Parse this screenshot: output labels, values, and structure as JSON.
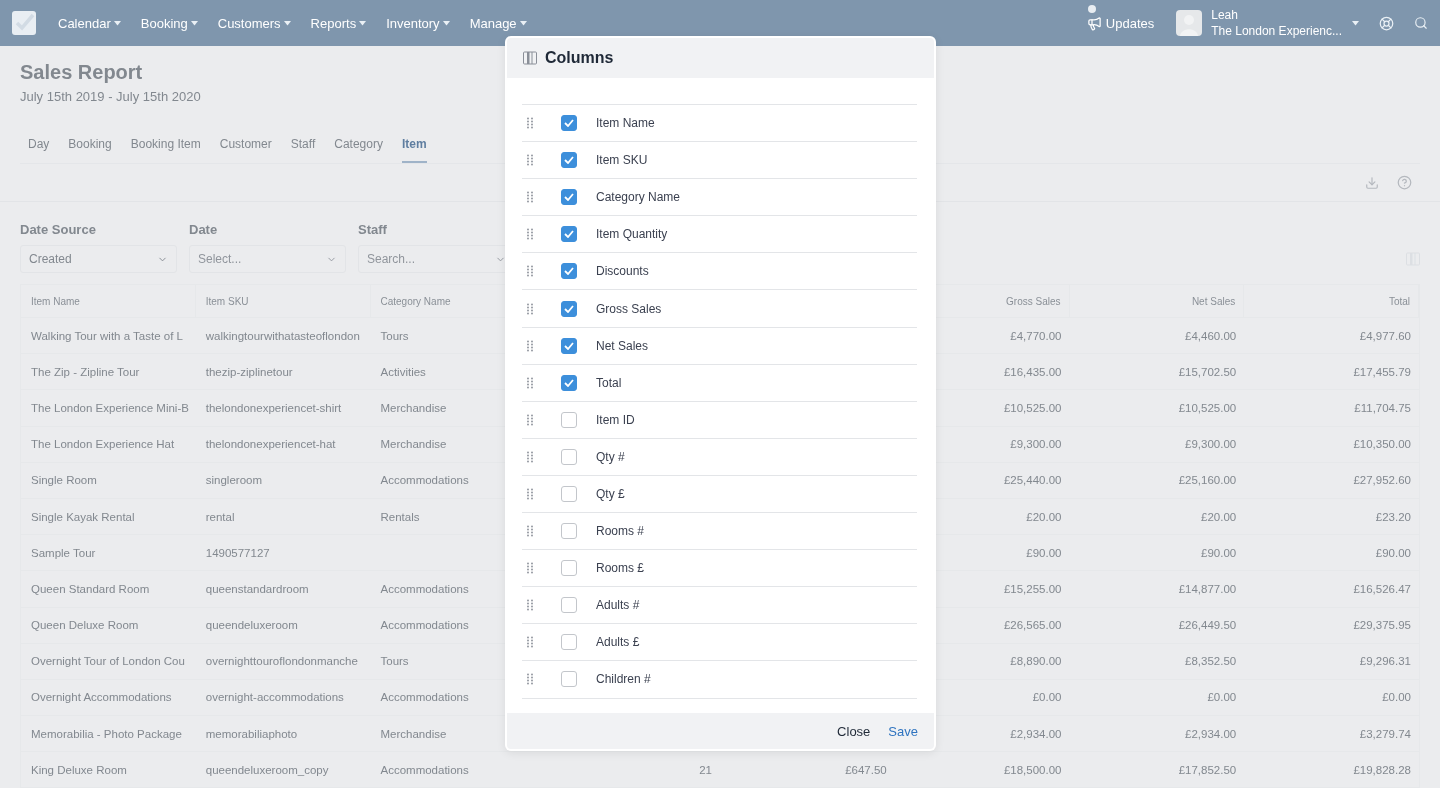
{
  "nav": {
    "menu": [
      {
        "label": "Calendar"
      },
      {
        "label": "Booking"
      },
      {
        "label": "Customers"
      },
      {
        "label": "Reports"
      },
      {
        "label": "Inventory"
      },
      {
        "label": "Manage"
      }
    ],
    "updates": {
      "label": "Updates",
      "unread": true
    },
    "user": {
      "name": "Leah",
      "org": "The London Experienc..."
    }
  },
  "report": {
    "title": "Sales Report",
    "subtitle": "July 15th 2019 - July 15th 2020",
    "tabs": [
      {
        "label": "Day",
        "selected": false
      },
      {
        "label": "Booking",
        "selected": false
      },
      {
        "label": "Booking Item",
        "selected": false
      },
      {
        "label": "Customer",
        "selected": false
      },
      {
        "label": "Staff",
        "selected": false
      },
      {
        "label": "Category",
        "selected": false
      },
      {
        "label": "Item",
        "selected": true
      }
    ]
  },
  "filters": [
    {
      "label": "Date Source",
      "value": "Created"
    },
    {
      "label": "Date",
      "placeholder": "Select..."
    },
    {
      "label": "Staff",
      "placeholder": "Search..."
    }
  ],
  "table": {
    "columns": {
      "item_name": "Item Name",
      "item_sku": "Item SKU",
      "category_name": "Category Name",
      "gross_sales": "Gross Sales",
      "net_sales": "Net Sales",
      "total": "Total"
    },
    "rows": [
      {
        "item_name": "Walking Tour with a Taste of L",
        "item_sku": "walkingtourwithatasteoflondon",
        "category_name": "Tours",
        "gross_sales": "£4,770.00",
        "net_sales": "£4,460.00",
        "total": "£4,977.60"
      },
      {
        "item_name": "The Zip - Zipline Tour",
        "item_sku": "thezip-ziplinetour",
        "category_name": "Activities",
        "gross_sales": "£16,435.00",
        "net_sales": "£15,702.50",
        "total": "£17,455.79"
      },
      {
        "item_name": "The London Experience Mini-B",
        "item_sku": "thelondonexperiencet-shirt",
        "category_name": "Merchandise",
        "gross_sales": "£10,525.00",
        "net_sales": "£10,525.00",
        "total": "£11,704.75"
      },
      {
        "item_name": "The London Experience Hat",
        "item_sku": "thelondonexperiencet-hat",
        "category_name": "Merchandise",
        "gross_sales": "£9,300.00",
        "net_sales": "£9,300.00",
        "total": "£10,350.00"
      },
      {
        "item_name": "Single Room",
        "item_sku": "singleroom",
        "category_name": "Accommodations",
        "gross_sales": "£25,440.00",
        "net_sales": "£25,160.00",
        "total": "£27,952.60"
      },
      {
        "item_name": "Single Kayak Rental",
        "item_sku": "rental",
        "category_name": "Rentals",
        "gross_sales": "£20.00",
        "net_sales": "£20.00",
        "total": "£23.20"
      },
      {
        "item_name": "Sample Tour",
        "item_sku": "1490577127",
        "gross_sales": "£90.00",
        "net_sales": "£90.00",
        "total": "£90.00"
      },
      {
        "item_name": "Queen Standard Room",
        "item_sku": "queenstandardroom",
        "category_name": "Accommodations",
        "gross_sales": "£15,255.00",
        "net_sales": "£14,877.00",
        "total": "£16,526.47"
      },
      {
        "item_name": "Queen Deluxe Room",
        "item_sku": "queendeluxeroom",
        "category_name": "Accommodations",
        "gross_sales": "£26,565.00",
        "net_sales": "£26,449.50",
        "total": "£29,375.95"
      },
      {
        "item_name": "Overnight Tour of London Cou",
        "item_sku": "overnighttouroflondonmanche",
        "category_name": "Tours",
        "gross_sales": "£8,890.00",
        "net_sales": "£8,352.50",
        "total": "£9,296.31"
      },
      {
        "item_name": "Overnight Accommodations",
        "item_sku": "overnight-accommodations",
        "category_name": "Accommodations",
        "gross_sales": "£0.00",
        "net_sales": "£0.00",
        "total": "£0.00"
      },
      {
        "item_name": "Memorabilia - Photo Package",
        "item_sku": "memorabiliaphoto",
        "category_name": "Merchandise",
        "gross_sales": "£2,934.00",
        "net_sales": "£2,934.00",
        "total": "£3,279.74"
      },
      {
        "item_name": "King Deluxe Room",
        "item_sku": "queendeluxeroom_copy",
        "category_name": "Accommodations",
        "item_quantity": "21",
        "discounts": "£647.50",
        "gross_sales": "£18,500.00",
        "net_sales": "£17,852.50",
        "total": "£19,828.28"
      }
    ]
  },
  "modal": {
    "title": "Columns",
    "columns": [
      {
        "label": "Item Name",
        "checked": true
      },
      {
        "label": "Item SKU",
        "checked": true
      },
      {
        "label": "Category Name",
        "checked": true
      },
      {
        "label": "Item Quantity",
        "checked": true
      },
      {
        "label": "Discounts",
        "checked": true
      },
      {
        "label": "Gross Sales",
        "checked": true
      },
      {
        "label": "Net Sales",
        "checked": true
      },
      {
        "label": "Total",
        "checked": true
      },
      {
        "label": "Item ID",
        "checked": false
      },
      {
        "label": "Qty #",
        "checked": false
      },
      {
        "label": "Qty £",
        "checked": false
      },
      {
        "label": "Rooms #",
        "checked": false
      },
      {
        "label": "Rooms £",
        "checked": false
      },
      {
        "label": "Adults #",
        "checked": false
      },
      {
        "label": "Adults £",
        "checked": false
      },
      {
        "label": "Children #",
        "checked": false
      }
    ],
    "buttons": [
      {
        "label": "Close",
        "kind": "secondary"
      },
      {
        "label": "Save",
        "kind": "primary"
      }
    ]
  }
}
